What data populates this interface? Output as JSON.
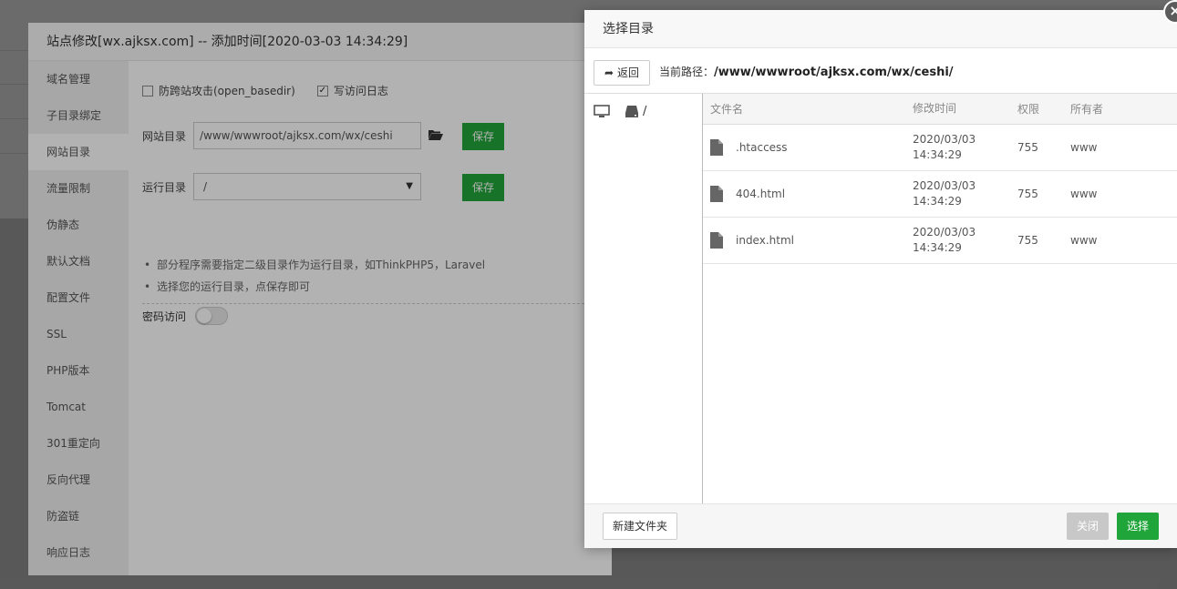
{
  "site_dialog": {
    "title": "站点修改[wx.ajksx.com] -- 添加时间[2020-03-03 14:34:29]",
    "menu": [
      {
        "label": "域名管理"
      },
      {
        "label": "子目录绑定"
      },
      {
        "label": "网站目录"
      },
      {
        "label": "流量限制"
      },
      {
        "label": "伪静态"
      },
      {
        "label": "默认文档"
      },
      {
        "label": "配置文件"
      },
      {
        "label": "SSL"
      },
      {
        "label": "PHP版本"
      },
      {
        "label": "Tomcat"
      },
      {
        "label": "301重定向"
      },
      {
        "label": "反向代理"
      },
      {
        "label": "防盗链"
      },
      {
        "label": "响应日志"
      }
    ],
    "active_menu": "网站目录",
    "anti_xss_label": "防跨站攻击(open_basedir)",
    "anti_xss_checked": false,
    "access_log_label": "写访问日志",
    "access_log_checked": true,
    "site_dir_label": "网站目录",
    "site_dir_value": "/www/wwwroot/ajksx.com/wx/ceshi",
    "save_label": "保存",
    "run_dir_label": "运行目录",
    "run_dir_value": "/",
    "tips": [
      "部分程序需要指定二级目录作为运行目录，如ThinkPHP5，Laravel",
      "选择您的运行目录，点保存即可"
    ],
    "password_label": "密码访问",
    "password_enabled": false
  },
  "picker": {
    "title": "选择目录",
    "back_label": "返回",
    "current_path_label": "当前路径：",
    "current_path": "/www/wwwroot/ajksx.com/wx/ceshi/",
    "tree_root": "/",
    "columns": {
      "name": "文件名",
      "time": "修改时间",
      "perm": "权限",
      "owner": "所有者"
    },
    "files": [
      {
        "name": ".htaccess",
        "date": "2020/03/03",
        "time": "14:34:29",
        "perm": "755",
        "owner": "www"
      },
      {
        "name": "404.html",
        "date": "2020/03/03",
        "time": "14:34:29",
        "perm": "755",
        "owner": "www"
      },
      {
        "name": "index.html",
        "date": "2020/03/03",
        "time": "14:34:29",
        "perm": "755",
        "owner": "www"
      }
    ],
    "new_folder_label": "新建文件夹",
    "close_label": "关闭",
    "select_label": "选择",
    "accent_color": "#20a53a"
  }
}
